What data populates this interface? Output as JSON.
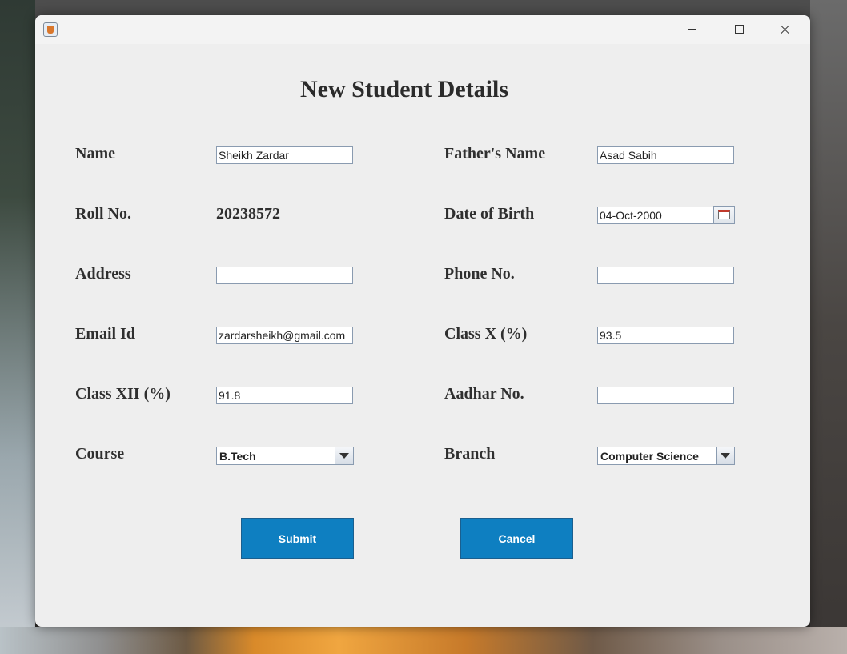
{
  "window": {
    "title": ""
  },
  "form": {
    "heading": "New Student Details",
    "labels": {
      "name": "Name",
      "roll_no": "Roll No.",
      "address": "Address",
      "email": "Email Id",
      "class_xii": "Class XII (%)",
      "course": "Course",
      "father_name": "Father's Name",
      "dob": "Date of Birth",
      "phone": "Phone No.",
      "class_x": "Class X (%)",
      "aadhar": "Aadhar No.",
      "branch": "Branch"
    },
    "values": {
      "name": "Sheikh Zardar",
      "roll_no": "20238572",
      "address": "",
      "email": "zardarsheikh@gmail.com",
      "class_xii": "91.8",
      "course": "B.Tech",
      "father_name": "Asad Sabih",
      "dob": "04-Oct-2000",
      "phone": "",
      "class_x": "93.5",
      "aadhar": "",
      "branch": "Computer Science"
    },
    "buttons": {
      "submit": "Submit",
      "cancel": "Cancel"
    }
  },
  "colors": {
    "button_bg": "#0e7fc1",
    "window_bg": "#eeeeee"
  },
  "icons": [
    "java-app-icon",
    "minimize-icon",
    "maximize-icon",
    "close-icon",
    "calendar-icon",
    "chevron-down-icon"
  ]
}
